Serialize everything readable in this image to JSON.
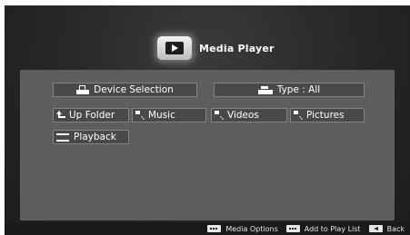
{
  "app": {
    "title": "Media Player"
  },
  "filters": {
    "device_selection": "Device Selection",
    "type": "Type : All"
  },
  "nav": {
    "up_folder": "Up Folder",
    "music": "Music",
    "videos": "Videos",
    "pictures": "Pictures",
    "playback": "Playback"
  },
  "footer": {
    "media_options": "Media Options",
    "add_to_play_list": "Add to Play List",
    "back": "Back"
  },
  "colors": {
    "panel": "#5e5e5e",
    "button": "#494949",
    "background": "#262626"
  }
}
